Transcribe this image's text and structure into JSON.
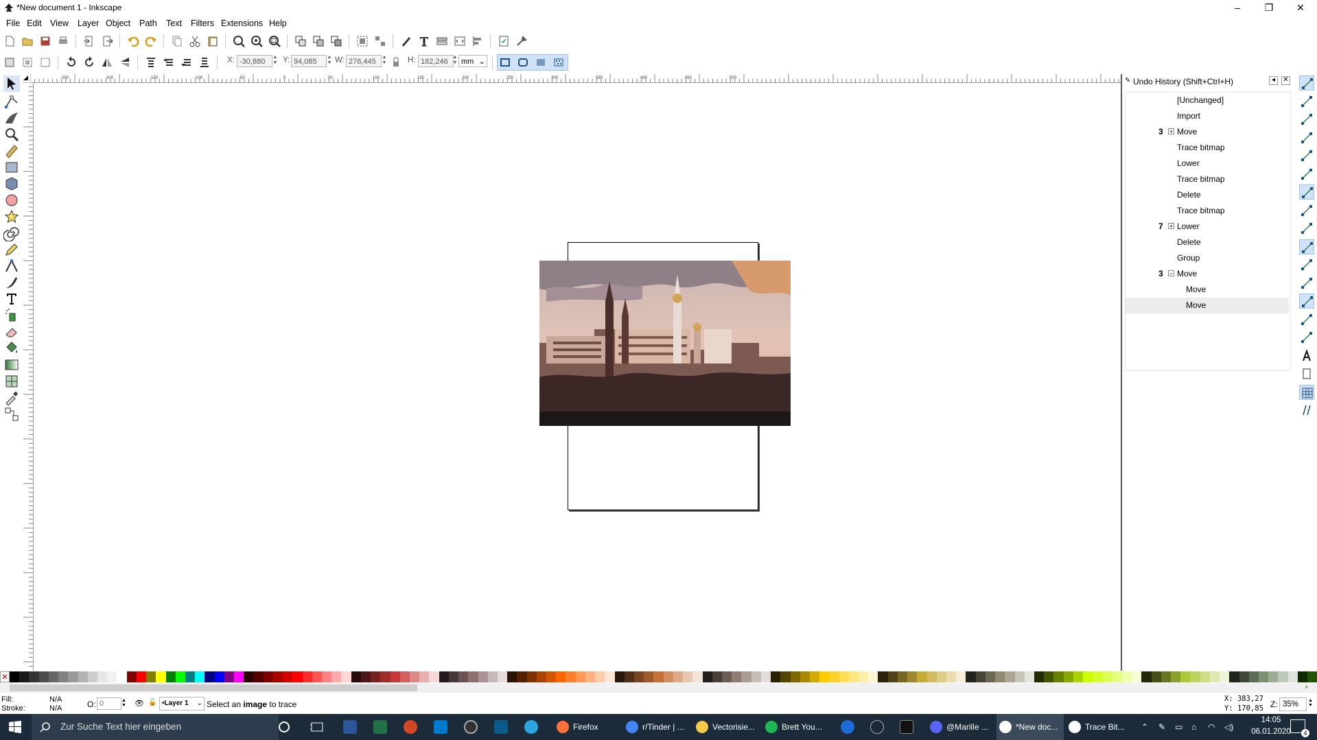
{
  "window": {
    "title": "*New document 1 - Inkscape",
    "controls": {
      "minimize": "–",
      "maximize": "❐",
      "close": "✕"
    }
  },
  "menu": [
    "File",
    "Edit",
    "View",
    "Layer",
    "Object",
    "Path",
    "Text",
    "Filters",
    "Extensions",
    "Help"
  ],
  "command_toolbar": {
    "icons": [
      "new-document-icon",
      "open-icon",
      "save-icon",
      "print-icon",
      "import-icon",
      "export-icon",
      "undo-icon",
      "redo-icon",
      "copy-icon",
      "cut-icon",
      "paste-icon",
      "zoom-selection-icon",
      "zoom-drawing-icon",
      "zoom-page-icon",
      "duplicate-icon",
      "clone-icon",
      "unlink-clone-icon",
      "group-icon",
      "ungroup-icon",
      "fill-stroke-icon",
      "text-font-icon",
      "layers-icon",
      "xml-editor-icon",
      "align-distribute-icon",
      "document-properties-icon",
      "preferences-icon"
    ]
  },
  "controls_toolbar": {
    "x_label": "X:",
    "x_value": "-30,880",
    "y_label": "Y:",
    "y_value": "94,085",
    "w_label": "W:",
    "w_value": "276,445",
    "h_label": "H:",
    "h_value": "182,246",
    "unit": "mm"
  },
  "tools": [
    "select-tool-icon",
    "node-tool-icon",
    "tweak-tool-icon",
    "zoom-tool-icon",
    "measure-tool-icon",
    "rectangle-tool-icon",
    "3d-box-tool-icon",
    "ellipse-tool-icon",
    "star-tool-icon",
    "spiral-tool-icon",
    "pencil-tool-icon",
    "pen-tool-icon",
    "calligraphy-tool-icon",
    "text-tool-icon",
    "spray-tool-icon",
    "eraser-tool-icon",
    "bucket-tool-icon",
    "gradient-tool-icon",
    "mesh-tool-icon",
    "dropper-tool-icon",
    "connector-tool-icon"
  ],
  "ruler": {
    "h_labels": [
      "-250",
      "-200",
      "-150",
      "-100",
      "-50",
      "0",
      "50",
      "100",
      "150",
      "200",
      "250",
      "300",
      "350",
      "400",
      "450",
      "500"
    ]
  },
  "undo_history": {
    "title": "Undo History (Shift+Ctrl+H)",
    "items": [
      {
        "count": "",
        "expander": "",
        "label": "[Unchanged]",
        "level": 0,
        "selected": false
      },
      {
        "count": "",
        "expander": "",
        "label": "Import",
        "level": 0,
        "selected": false
      },
      {
        "count": "3",
        "expander": "+",
        "label": "Move",
        "level": 0,
        "selected": false
      },
      {
        "count": "",
        "expander": "",
        "label": "Trace bitmap",
        "level": 0,
        "selected": false
      },
      {
        "count": "",
        "expander": "",
        "label": "Lower",
        "level": 0,
        "selected": false
      },
      {
        "count": "",
        "expander": "",
        "label": "Trace bitmap",
        "level": 0,
        "selected": false
      },
      {
        "count": "",
        "expander": "",
        "label": "Delete",
        "level": 0,
        "selected": false
      },
      {
        "count": "",
        "expander": "",
        "label": "Trace bitmap",
        "level": 0,
        "selected": false
      },
      {
        "count": "7",
        "expander": "+",
        "label": "Lower",
        "level": 0,
        "selected": false
      },
      {
        "count": "",
        "expander": "",
        "label": "Delete",
        "level": 0,
        "selected": false
      },
      {
        "count": "",
        "expander": "",
        "label": "Group",
        "level": 0,
        "selected": false
      },
      {
        "count": "3",
        "expander": "−",
        "label": "Move",
        "level": 0,
        "selected": false
      },
      {
        "count": "",
        "expander": "",
        "label": "Move",
        "level": 1,
        "selected": false
      },
      {
        "count": "",
        "expander": "",
        "label": "Move",
        "level": 1,
        "selected": true
      }
    ]
  },
  "snap_controls": [
    "snap-enable-icon",
    "snap-bbox-icon",
    "snap-bbox-edge-icon",
    "snap-bbox-corner-icon",
    "snap-bbox-midpoint-icon",
    "snap-bbox-center-icon",
    "snap-nodes-icon",
    "snap-path-icon",
    "snap-intersection-icon",
    "snap-cusp-icon",
    "snap-smooth-icon",
    "snap-midpoint-icon",
    "snap-others-icon",
    "snap-object-center-icon",
    "snap-rotation-center-icon",
    "snap-text-baseline-icon",
    "snap-page-icon",
    "snap-grid-icon",
    "snap-guide-icon"
  ],
  "palette": [
    "#000000",
    "#1a1a1a",
    "#333333",
    "#4d4d4d",
    "#666666",
    "#808080",
    "#999999",
    "#b3b3b3",
    "#cccccc",
    "#e6e6e6",
    "#f2f2f2",
    "#ffffff",
    "#800000",
    "#ff0000",
    "#808000",
    "#ffff00",
    "#008000",
    "#00ff00",
    "#008080",
    "#00ffff",
    "#000080",
    "#0000ff",
    "#800080",
    "#ff00ff",
    "#2b0000",
    "#550000",
    "#800000",
    "#aa0000",
    "#d40000",
    "#ff0000",
    "#ff2a2a",
    "#ff5555",
    "#ff8080",
    "#ffaaaa",
    "#ffd5d5",
    "#280b0b",
    "#501616",
    "#782121",
    "#a02c2c",
    "#c83737",
    "#d35f5f",
    "#de8787",
    "#e9afaf",
    "#f4d7d7",
    "#241c1c",
    "#483737",
    "#6c5353",
    "#916f6f",
    "#ac9393",
    "#c8b7b7",
    "#e3dbdb",
    "#2b1100",
    "#552200",
    "#803300",
    "#aa4400",
    "#d45500",
    "#ff6600",
    "#ff7f2a",
    "#ff9955",
    "#ffb380",
    "#ffccaa",
    "#ffe6d5",
    "#28170b",
    "#502d16",
    "#784421",
    "#a05a2c",
    "#c87137",
    "#d38d5f",
    "#deaa87",
    "#e9c6af",
    "#f4e3d7",
    "#241f1c",
    "#483e37",
    "#6c5d53",
    "#917c6f",
    "#ac9d93",
    "#c8beb7",
    "#e3dedb",
    "#2b2200",
    "#554400",
    "#806600",
    "#aa8800",
    "#d4aa00",
    "#ffcc00",
    "#ffd42a",
    "#ffdd55",
    "#ffe680",
    "#ffeeaa",
    "#fff6d5",
    "#28220b",
    "#504416",
    "#786721",
    "#a0892c",
    "#c8ab37",
    "#d3bc5f",
    "#decd87",
    "#e9ddaf",
    "#f4eed7",
    "#24221c",
    "#484537",
    "#6c6753",
    "#918a6f",
    "#aca793",
    "#c8c4b7",
    "#e3e2db",
    "#222b00",
    "#445500",
    "#668000",
    "#88aa00",
    "#aad400",
    "#ccff00",
    "#d4ff2a",
    "#ddff55",
    "#e5ff80",
    "#eeffaa",
    "#f6ffd5",
    "#22280b",
    "#445016",
    "#677821",
    "#89a02c",
    "#abc837",
    "#bcd35f",
    "#cdde87",
    "#dde9af",
    "#eef4d7",
    "#1f241c",
    "#3e4837",
    "#5d6c53",
    "#7c916f",
    "#9dac93",
    "#bec8b7",
    "#dee3db",
    "#112b00",
    "#225500"
  ],
  "status": {
    "fill_label": "Fill:",
    "fill_value": "N/A",
    "stroke_label": "Stroke:",
    "stroke_value": "N/A",
    "opacity_label": "O:",
    "opacity_value": "0",
    "layer": "•Layer 1",
    "message_prefix": "Select an ",
    "message_bold": "image",
    "message_suffix": " to trace",
    "x_coord": "X: 383,27",
    "y_coord": "Y: 170,85",
    "zoom_label": "Z:",
    "zoom_value": "35%"
  },
  "taskbar": {
    "search_placeholder": "Zur Suche Text hier eingeben",
    "apps": [
      {
        "label": "Firefox",
        "color": "#ff7139"
      },
      {
        "label": "r/Tinder | ...",
        "color": "#4285f4"
      },
      {
        "label": "Vectorisie...",
        "color": "#f2c94c"
      },
      {
        "label": "Brett You...",
        "color": "#1db954"
      },
      {
        "label": "@Marille ...",
        "color": "#5865f2"
      },
      {
        "label": "*New doc...",
        "color": "#ffffff"
      },
      {
        "label": "Trace Bit...",
        "color": "#ffffff"
      }
    ],
    "time": "14:05",
    "date": "06.01.2020",
    "notifications": "4"
  },
  "colors": {
    "accent": "#0078d7",
    "taskbar": "#1c2b3a",
    "snap_active": "#cfe2f7"
  }
}
